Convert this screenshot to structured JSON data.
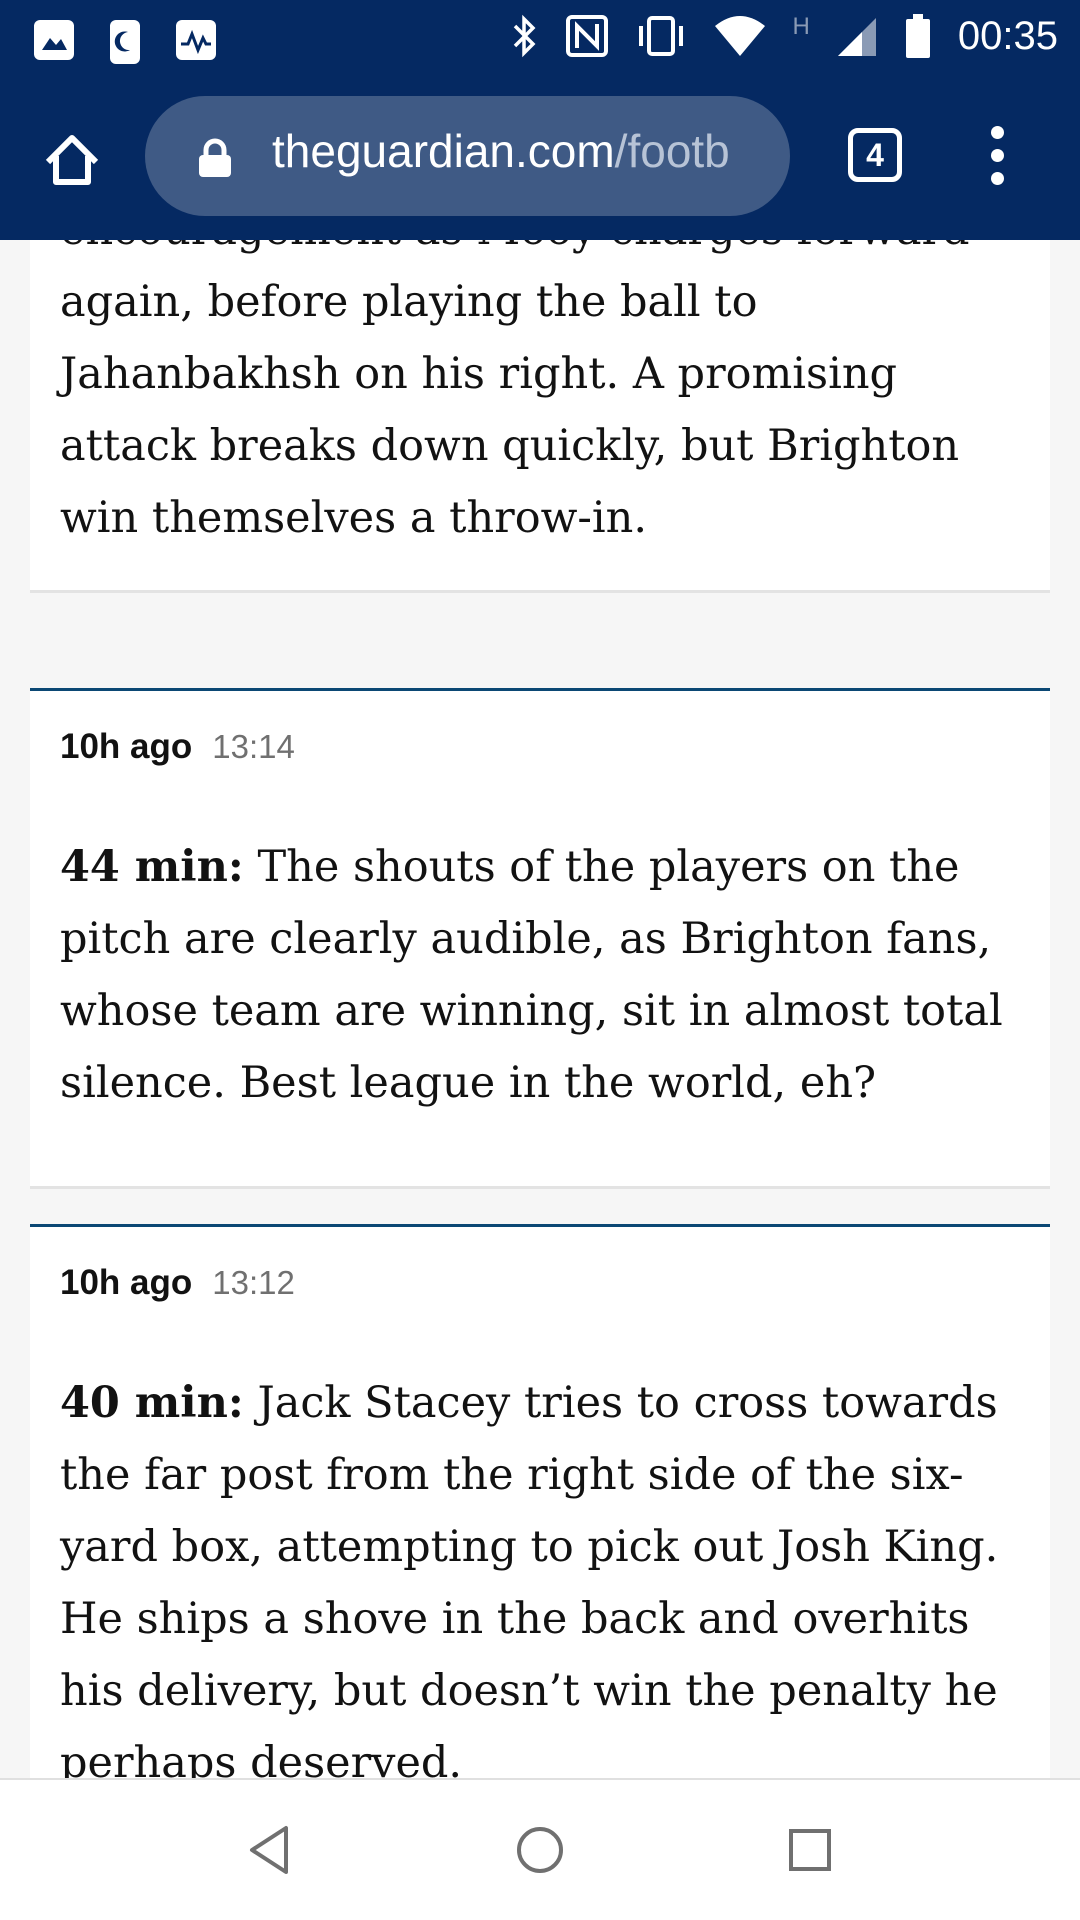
{
  "status_bar": {
    "time": "00:35",
    "left_icons": [
      "gallery-icon",
      "night-mode-icon",
      "activity-icon"
    ],
    "right_icons": [
      "bluetooth-icon",
      "nfc-icon",
      "vibrate-icon",
      "wifi-icon",
      "network-h-icon",
      "signal-icon",
      "battery-icon"
    ],
    "network_label": "H"
  },
  "browser": {
    "url_host": "theguardian.com",
    "url_path": "/footb",
    "tab_count": "4"
  },
  "posts": [
    {
      "text": "encouragement as Mooy charges forward again, before playing the ball to Jahanbakhsh on his right. A promising attack breaks down quickly, but Brighton win themselves a throw-in."
    },
    {
      "ago": "10h ago",
      "time": "13:14",
      "minute": "44 min:",
      "text": "The shouts of the players on the pitch are clearly audible, as Brighton fans, whose team are winning, sit in almost total silence. Best league in the world, eh?"
    },
    {
      "ago": "10h ago",
      "time": "13:12",
      "minute": "40 min:",
      "text": "Jack Stacey tries to cross towards the far post from the right side of the six-yard box, attempting to pick out Josh King. He ships a shove in the back and overhits his delivery, but doesn’t win the penalty he perhaps deserved."
    }
  ],
  "colors": {
    "header_bg": "#052962",
    "url_pill_bg": "#3f5a85",
    "post_border": "#0b4874"
  }
}
